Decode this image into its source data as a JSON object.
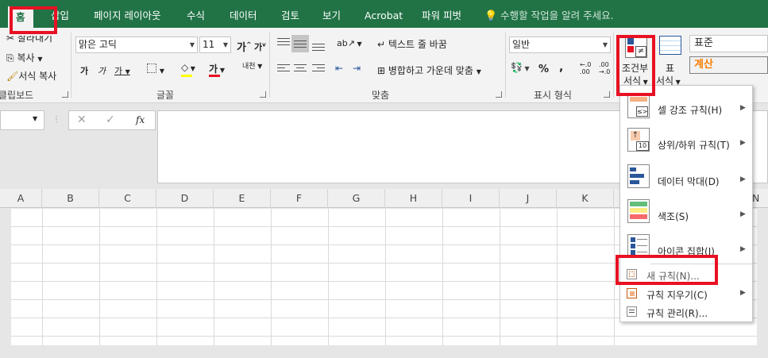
{
  "tabs": [
    "홈",
    "삽입",
    "페이지 레이아웃",
    "수식",
    "데이터",
    "검토",
    "보기",
    "Acrobat",
    "파워 피벗"
  ],
  "tell_me": "수행할 작업을 알려 주세요.",
  "clipboard": {
    "cut": "잘라내기",
    "copy": "복사",
    "format_painter": "서식 복사",
    "group": "클립보드"
  },
  "font": {
    "name": "맑은 고딕",
    "size": "11",
    "grow": "가",
    "shrink": "가",
    "bold": "가",
    "italic": "가",
    "underline": "가",
    "color_glyph": "가",
    "phonetic": "내천",
    "group": "글꼴"
  },
  "alignment": {
    "wrap": "텍스트 줄 바꿈",
    "merge": "병합하고 가운데 맞춤",
    "group": "맞춤"
  },
  "number": {
    "format": "일반",
    "percent": "%",
    "comma": ",",
    "inc": ".0\n.00",
    "group": "표시 형식"
  },
  "styles": {
    "conditional_line1": "조건부",
    "conditional_line2": "서식",
    "table_line1": "표",
    "table_line2": "서식",
    "cell_style_1": "표준",
    "cell_style_2": "계산"
  },
  "formula_bar": {
    "cancel": "✕",
    "enter": "✓",
    "fx": "fx"
  },
  "columns": [
    "A",
    "B",
    "C",
    "D",
    "E",
    "F",
    "G",
    "H",
    "I",
    "J",
    "K",
    "N"
  ],
  "menu": {
    "items": [
      {
        "label": "셀 강조 규칙(H)"
      },
      {
        "label": "상위/하위 규칙(T)"
      },
      {
        "label": "데이터 막대(D)"
      },
      {
        "label": "색조(S)"
      },
      {
        "label": "아이콘 집합(I)"
      },
      {
        "label": "새 규칙(N)..."
      },
      {
        "label": "규칙 지우기(C)"
      },
      {
        "label": "규칙 관리(R)..."
      }
    ],
    "topbottom_icon_text": "10"
  },
  "colors": {
    "excel_green": "#217346",
    "highlight_red": "#e81123",
    "cell_style_calc_bg": "#f2f2f2",
    "calc_text": "#fa7d00"
  }
}
